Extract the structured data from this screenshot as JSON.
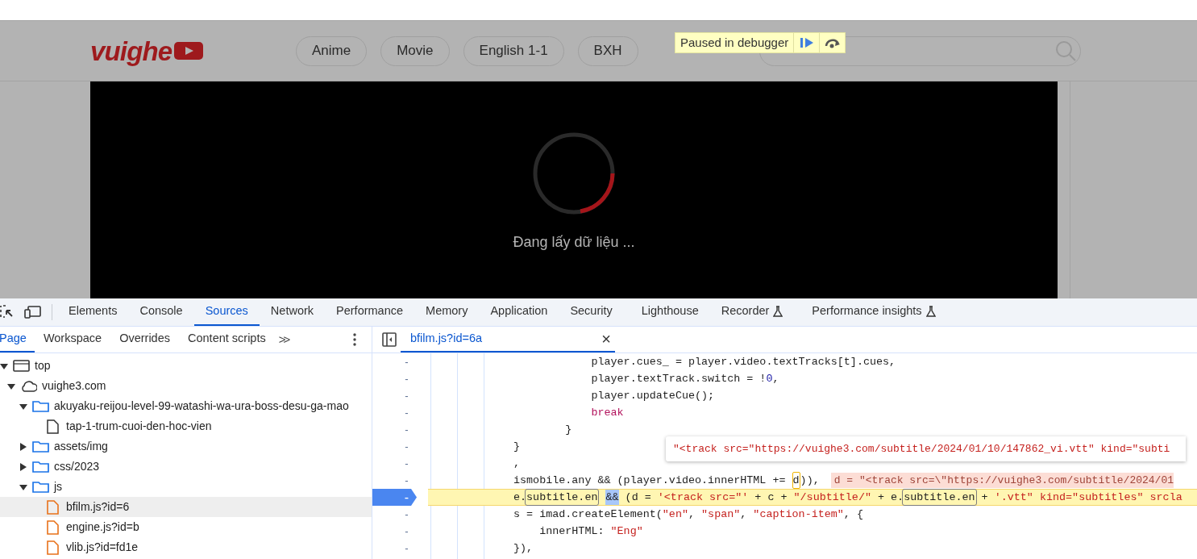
{
  "site": {
    "logo": "vuighe",
    "nav": [
      "Anime",
      "Movie",
      "English 1-1",
      "BXH"
    ],
    "video": {
      "loading_text": "Đang lấy dữ liệu ..."
    }
  },
  "debugger_overlay": {
    "label": "Paused in debugger"
  },
  "devtools": {
    "tabs": [
      {
        "label": "Elements",
        "selected": false,
        "kind": "plain"
      },
      {
        "label": "Console",
        "selected": false,
        "kind": "plain"
      },
      {
        "label": "Sources",
        "selected": true,
        "kind": "plain"
      },
      {
        "label": "Network",
        "selected": false,
        "kind": "plain"
      },
      {
        "label": "Performance",
        "selected": false,
        "kind": "plain"
      },
      {
        "label": "Memory",
        "selected": false,
        "kind": "plain"
      },
      {
        "label": "Application",
        "selected": false,
        "kind": "plain"
      },
      {
        "label": "Security",
        "selected": false,
        "kind": "plain"
      },
      {
        "label": "Lighthouse",
        "selected": false,
        "kind": "plain"
      },
      {
        "label": "Recorder",
        "selected": false,
        "kind": "experimental"
      },
      {
        "label": "Performance insights",
        "selected": false,
        "kind": "experimental"
      }
    ],
    "navigator_tabs": [
      {
        "label": "Page",
        "selected": true
      },
      {
        "label": "Workspace",
        "selected": false
      },
      {
        "label": "Overrides",
        "selected": false
      },
      {
        "label": "Content scripts",
        "selected": false
      }
    ],
    "more_tabs": ">>",
    "tree": [
      {
        "label": "top",
        "kind": "frame",
        "expanded": true,
        "selected": false,
        "children": [
          {
            "label": "vuighe3.com",
            "kind": "domain",
            "expanded": true,
            "selected": false,
            "children": [
              {
                "label": "akuyaku-reijou-level-99-watashi-wa-ura-boss-desu-ga-mao",
                "kind": "folder",
                "expanded": true,
                "selected": false,
                "children": [
                  {
                    "label": "tap-1-trum-cuoi-den-hoc-vien",
                    "kind": "document",
                    "selected": false
                  }
                ]
              },
              {
                "label": "assets/img",
                "kind": "folder",
                "expanded": false,
                "selected": false
              },
              {
                "label": "css/2023",
                "kind": "folder",
                "expanded": false,
                "selected": false
              },
              {
                "label": "js",
                "kind": "folder",
                "expanded": true,
                "selected": false,
                "children": [
                  {
                    "label": "bfilm.js?id=6",
                    "kind": "script",
                    "selected": true
                  },
                  {
                    "label": "engine.js?id=b",
                    "kind": "script",
                    "selected": false
                  },
                  {
                    "label": "vlib.js?id=fd1e",
                    "kind": "script",
                    "selected": false
                  }
                ]
              }
            ]
          }
        ]
      }
    ],
    "editor_tab": {
      "label": "bfilm.js?id=6a",
      "close": "×"
    },
    "code": [
      {
        "gutter": "-",
        "paused": false,
        "segments": [
          {
            "kind": "plain",
            "text": "            player.cues_ = player.video.textTracks[t].cues,"
          }
        ]
      },
      {
        "gutter": "-",
        "paused": false,
        "segments": [
          {
            "kind": "plain",
            "text": "            player.textTrack.switch = !"
          },
          {
            "kind": "number",
            "text": "0"
          },
          {
            "kind": "plain",
            "text": ","
          }
        ]
      },
      {
        "gutter": "-",
        "paused": false,
        "segments": [
          {
            "kind": "plain",
            "text": "            player.updateCue();"
          }
        ]
      },
      {
        "gutter": "-",
        "paused": false,
        "segments": [
          {
            "kind": "keyword",
            "text": "            break"
          }
        ]
      },
      {
        "gutter": "-",
        "paused": false,
        "segments": [
          {
            "kind": "plain",
            "text": "        }"
          }
        ]
      },
      {
        "gutter": "-",
        "paused": false,
        "segments": [
          {
            "kind": "plain",
            "text": "}"
          }
        ]
      },
      {
        "gutter": "-",
        "paused": false,
        "segments": [
          {
            "kind": "plain",
            "text": ","
          }
        ]
      },
      {
        "gutter": "-",
        "paused": false,
        "segments": [
          {
            "kind": "plain",
            "text": "ismobile.any && (player.video.innerHTML += "
          },
          {
            "kind": "current",
            "text": "d"
          },
          {
            "kind": "plain",
            "text": ")), "
          },
          {
            "kind": "inline-value",
            "text": "d = \"<track src=\\\"https://vuighe3.com/subtitle/2024/01"
          }
        ]
      },
      {
        "gutter": "-",
        "paused": true,
        "segments": [
          {
            "kind": "plain",
            "text": "e."
          },
          {
            "kind": "boxed",
            "text": "subtitle.en"
          },
          {
            "kind": "selected",
            "text": "&&"
          },
          {
            "kind": "plain",
            "text": " (d = "
          },
          {
            "kind": "string",
            "text": "'<track src=\"'"
          },
          {
            "kind": "plain",
            "text": " + c + "
          },
          {
            "kind": "string",
            "text": "\"/subtitle/\""
          },
          {
            "kind": "plain",
            "text": " + e."
          },
          {
            "kind": "boxed",
            "text": "subtitle.en"
          },
          {
            "kind": "plain",
            "text": " + "
          },
          {
            "kind": "string",
            "text": "'.vtt\" kind=\"subtitles\" srcla"
          }
        ]
      },
      {
        "gutter": "-",
        "paused": false,
        "segments": [
          {
            "kind": "plain",
            "text": "s = imad.createElement("
          },
          {
            "kind": "string",
            "text": "\"en\""
          },
          {
            "kind": "plain",
            "text": ", "
          },
          {
            "kind": "string",
            "text": "\"span\""
          },
          {
            "kind": "plain",
            "text": ", "
          },
          {
            "kind": "string",
            "text": "\"caption-item\""
          },
          {
            "kind": "plain",
            "text": ", {"
          }
        ]
      },
      {
        "gutter": "-",
        "paused": false,
        "segments": [
          {
            "kind": "plain",
            "text": "    innerHTML: "
          },
          {
            "kind": "string",
            "text": "\"Eng\""
          }
        ]
      },
      {
        "gutter": "-",
        "paused": false,
        "segments": [
          {
            "kind": "plain",
            "text": "}),"
          }
        ]
      }
    ],
    "tooltip": "\"<track src=\"https://vuighe3.com/subtitle/2024/01/10/147862_vi.vtt\" kind=\"subti"
  }
}
